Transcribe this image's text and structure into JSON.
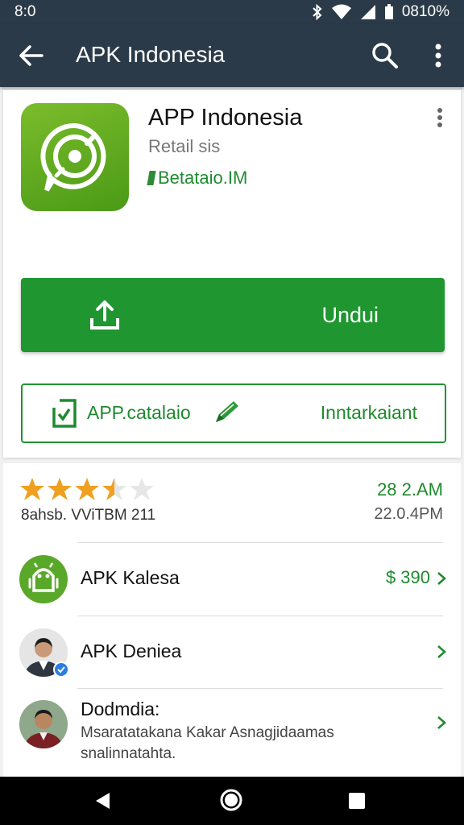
{
  "status": {
    "time": "8:0",
    "battery": "0810%"
  },
  "appbar": {
    "title": "APK Indonesia",
    "back_icon": "arrow-back-icon",
    "search_icon": "search-icon",
    "more_icon": "more-vert-icon"
  },
  "app": {
    "name": "APP Indonesia",
    "developer": "Retail sis",
    "badge": "Betataio.IM",
    "icon": "chat-bubble-compass-icon",
    "accent": "#1f9630"
  },
  "install_button": {
    "label": "Undui",
    "icon": "upload-icon"
  },
  "secondary_button": {
    "left_label": "APP.catalaio",
    "right_label": "Inntarkaiant",
    "left_icon": "document-check-icon",
    "right_icon": "pencil-icon"
  },
  "rating": {
    "stars": 3.5,
    "max_stars": 5,
    "caption": "8ahsb.  VViTBM  211",
    "right_top": "28 2.AM",
    "right_bottom": "22.0.4PM"
  },
  "list": [
    {
      "title": "APK Kalesa",
      "value": "$ 390",
      "icon": "android-robot-icon"
    },
    {
      "title": "APK Deniea",
      "value": "",
      "icon": "person-avatar"
    },
    {
      "title": "Dodmdia:",
      "subtitle": "Msaratatakana Kakar Asnagjidaamas snalinnatahta.",
      "value": "",
      "icon": "person-avatar"
    }
  ],
  "navbar": {
    "back": "nav-back-icon",
    "home": "nav-home-icon",
    "recent": "nav-recent-icon"
  }
}
